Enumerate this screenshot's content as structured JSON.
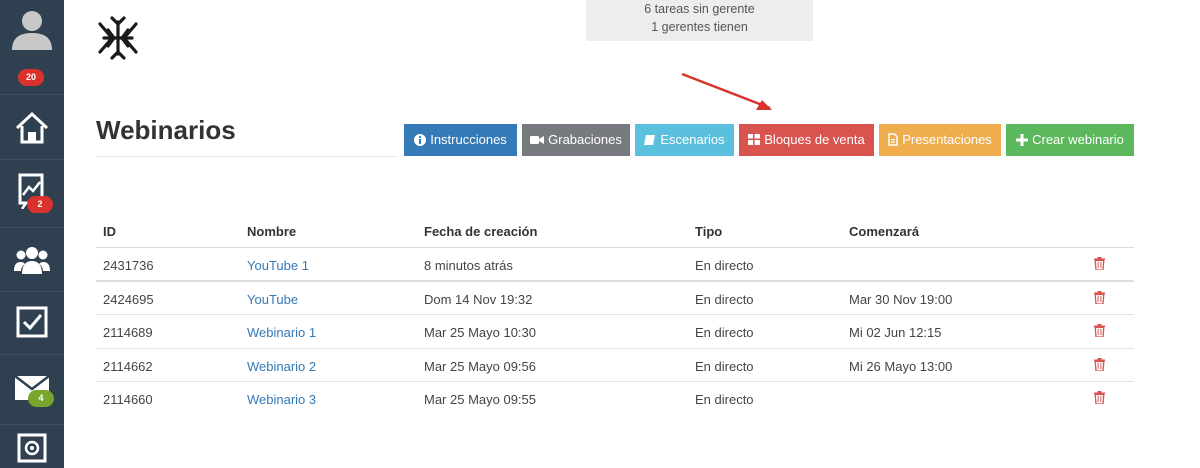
{
  "sidebar": {
    "items": [
      {
        "name": "user-avatar",
        "badge": "20",
        "badge_color": "#d9322d"
      },
      {
        "name": "home",
        "badge": ""
      },
      {
        "name": "reports",
        "badge": "2",
        "badge_color": "#d9322d"
      },
      {
        "name": "team",
        "badge": ""
      },
      {
        "name": "tasks",
        "badge": ""
      },
      {
        "name": "mail",
        "badge": "4",
        "badge_color": "#78a52d"
      },
      {
        "name": "safe",
        "badge": ""
      }
    ]
  },
  "notice": {
    "line1": "6 tareas sin gerente",
    "line2": "1 gerentes tienen"
  },
  "page": {
    "title": "Webinarios"
  },
  "toolbar": {
    "instrucciones": "Instrucciones",
    "grabaciones": "Grabaciones",
    "escenarios": "Escenarios",
    "bloques": "Bloques de venta",
    "presentaciones": "Presentaciones",
    "crear": "Crear webinario"
  },
  "colors": {
    "sidebar": "#2f4050",
    "primary": "#337ab7",
    "danger": "#d9534f",
    "success": "#5cb85c",
    "warning": "#f0ad4e",
    "info": "#5bc0de",
    "arrow": "#d9322d"
  },
  "table": {
    "headers": {
      "id": "ID",
      "nombre": "Nombre",
      "fecha": "Fecha de creación",
      "tipo": "Tipo",
      "comenzara": "Comenzará"
    },
    "rows": [
      {
        "id": "2431736",
        "nombre": "YouTube 1",
        "fecha": "8 minutos atrás",
        "tipo": "En directo",
        "comenzara": ""
      },
      {
        "id": "2424695",
        "nombre": "YouTube",
        "fecha": "Dom 14 Nov 19:32",
        "tipo": "En directo",
        "comenzara": "Mar 30 Nov 19:00"
      },
      {
        "id": "2114689",
        "nombre": "Webinario 1",
        "fecha": "Mar 25 Mayo 10:30",
        "tipo": "En directo",
        "comenzara": "Mi 02 Jun 12:15"
      },
      {
        "id": "2114662",
        "nombre": "Webinario 2",
        "fecha": "Mar 25 Mayo 09:56",
        "tipo": "En directo",
        "comenzara": "Mi 26 Mayo 13:00"
      },
      {
        "id": "2114660",
        "nombre": "Webinario 3",
        "fecha": "Mar 25 Mayo 09:55",
        "tipo": "En directo",
        "comenzara": ""
      }
    ]
  }
}
